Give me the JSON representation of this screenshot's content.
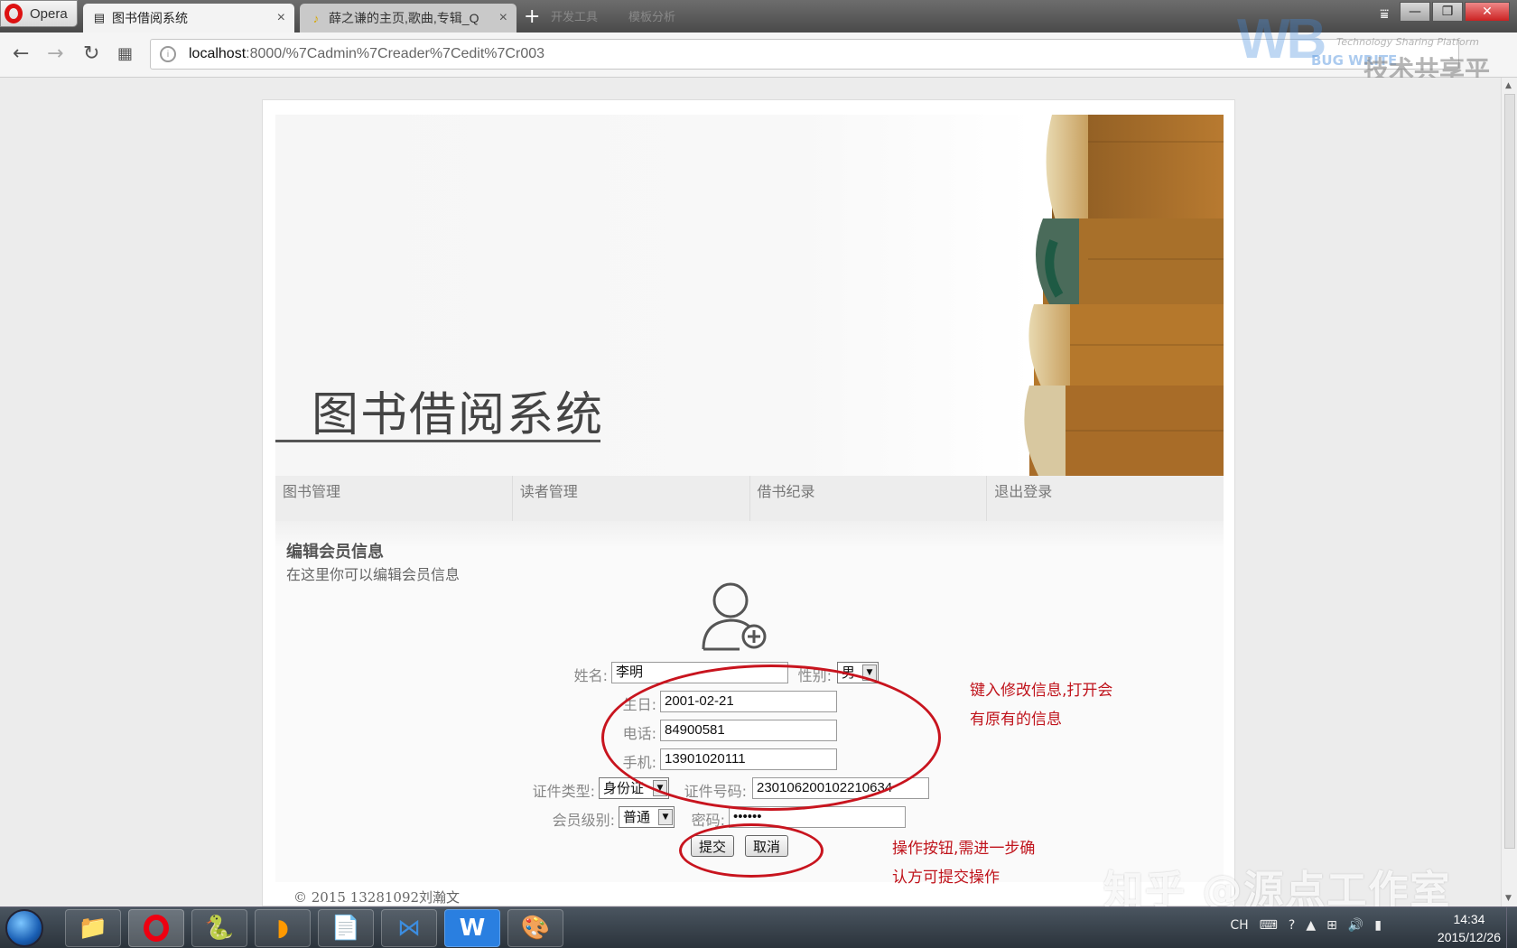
{
  "browser": {
    "menu_label": "Opera",
    "tabs": [
      {
        "title": "图书借阅系统",
        "close": "×",
        "active": true
      },
      {
        "title": "薛之谦的主页,歌曲,专辑_Q",
        "close": "×",
        "active": false
      }
    ],
    "new_tab": "+",
    "faded_tabs": [
      "开发工具",
      "模板分析"
    ],
    "url_host": "localhost",
    "url_path": ":8000/%7Cadmin%7Creader%7Cedit%7Cr003"
  },
  "watermark": {
    "logo_text": "WB",
    "logo_sub": "BUG WRITE",
    "tagline": "Technology Sharing Platform",
    "cn": "技术共享平台"
  },
  "site": {
    "banner_title": "图书借阅系统",
    "menu": [
      "图书管理",
      "读者管理",
      "借书纪录",
      "退出登录"
    ],
    "section_title": "编辑会员信息",
    "section_subtitle": "在这里你可以编辑会员信息",
    "form": {
      "name_label": "姓名:",
      "name_value": "李明",
      "gender_label": "性别:",
      "gender_value": "男",
      "birthday_label": "生日:",
      "birthday_value": "2001-02-21",
      "phone_label": "电话:",
      "phone_value": "84900581",
      "mobile_label": "手机:",
      "mobile_value": "13901020111",
      "id_type_label": "证件类型:",
      "id_type_value": "身份证",
      "id_number_label": "证件号码:",
      "id_number_value": "230106200102210634",
      "level_label": "会员级别:",
      "level_value": "普通",
      "password_label": "密码:",
      "password_value": "••••••",
      "submit_label": "提交",
      "cancel_label": "取消"
    },
    "footer": "© 2015  13281092刘瀚文"
  },
  "annotations": {
    "info_line1": "键入修改信息,打开会",
    "info_line2": "有原有的信息",
    "buttons_line1": "操作按钮,需进一步确",
    "buttons_line2": "认方可提交操作",
    "annotation_color": "#c0141c"
  },
  "overlay_watermark": "知乎 @源点工作室",
  "taskbar": {
    "apps": [
      "file-explorer",
      "opera",
      "python-idle",
      "sublime",
      "python-file",
      "visual-studio",
      "wps",
      "paint"
    ],
    "input_lang": "CH",
    "time": "14:34",
    "date": "2015/12/26"
  }
}
